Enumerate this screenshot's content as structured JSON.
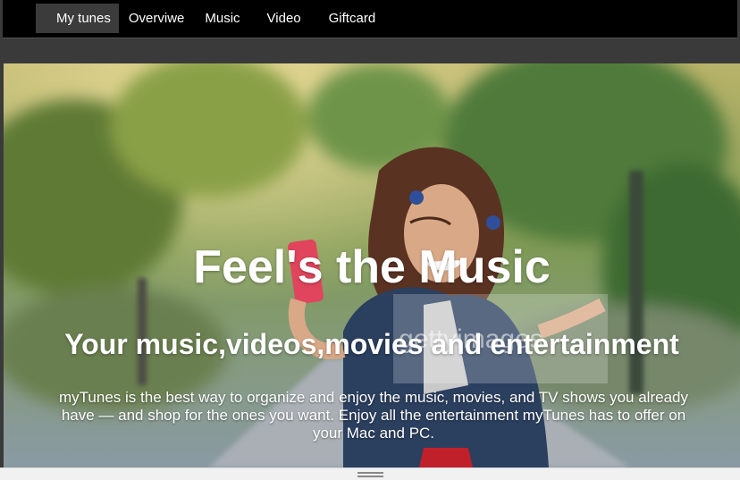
{
  "nav": {
    "items": [
      {
        "label": "My tunes",
        "active": true
      },
      {
        "label": "Overviwe"
      },
      {
        "label": "Music"
      },
      {
        "label": "Video"
      },
      {
        "label": "Giftcard"
      }
    ]
  },
  "hero": {
    "title": "Feel's the Music",
    "subtitle": "Your music,videos,movies and entertainment",
    "description": "myTunes is the best way to organize and enjoy the music, movies, and TV shows you already have — and shop for the ones you want. Enjoy all the entertainment myTunes has to offer on your Mac and PC.",
    "watermark": "gettyimages"
  },
  "colors": {
    "navbar_bg": "#000000",
    "active_tab_bg": "#3b3b3b",
    "page_bg": "#3a3a3a"
  }
}
